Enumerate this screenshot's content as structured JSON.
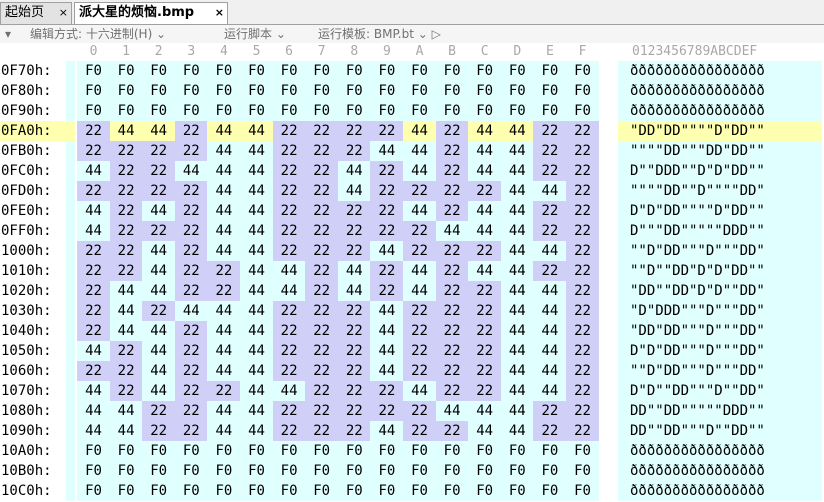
{
  "tabs": [
    {
      "label": "起始页",
      "close": "×"
    },
    {
      "label": "派大星的烦恼.bmp",
      "close": "×"
    }
  ],
  "toolbar": {
    "left_marker": "▾",
    "edit_mode": "编辑方式: 十六进制(H) ⌄",
    "run_script": "运行脚本 ⌄",
    "run_template": "运行模板: BMP.bt ⌄ ▷"
  },
  "column_header": {
    "hex_cols": [
      "0",
      "1",
      "2",
      "3",
      "4",
      "5",
      "6",
      "7",
      "8",
      "9",
      "A",
      "B",
      "C",
      "D",
      "E",
      "F"
    ],
    "ascii": "0123456789ABCDEF"
  },
  "selected_row": "0FA0h:",
  "rows": [
    {
      "addr": "0F70h:",
      "bytes": [
        "F0",
        "F0",
        "F0",
        "F0",
        "F0",
        "F0",
        "F0",
        "F0",
        "F0",
        "F0",
        "F0",
        "F0",
        "F0",
        "F0",
        "F0",
        "F0"
      ],
      "ascii": "ðððððððððððððððð"
    },
    {
      "addr": "0F80h:",
      "bytes": [
        "F0",
        "F0",
        "F0",
        "F0",
        "F0",
        "F0",
        "F0",
        "F0",
        "F0",
        "F0",
        "F0",
        "F0",
        "F0",
        "F0",
        "F0",
        "F0"
      ],
      "ascii": "ðððððððððððððððð"
    },
    {
      "addr": "0F90h:",
      "bytes": [
        "F0",
        "F0",
        "F0",
        "F0",
        "F0",
        "F0",
        "F0",
        "F0",
        "F0",
        "F0",
        "F0",
        "F0",
        "F0",
        "F0",
        "F0",
        "F0"
      ],
      "ascii": "ðððððððððððððððð"
    },
    {
      "addr": "0FA0h:",
      "bytes": [
        "22",
        "44",
        "44",
        "22",
        "44",
        "44",
        "22",
        "22",
        "22",
        "22",
        "44",
        "22",
        "44",
        "44",
        "22",
        "22"
      ],
      "ascii": "\"DD\"DD\"\"\"\"D\"DD\"\""
    },
    {
      "addr": "0FB0h:",
      "bytes": [
        "22",
        "22",
        "22",
        "22",
        "44",
        "44",
        "22",
        "22",
        "22",
        "44",
        "44",
        "22",
        "44",
        "44",
        "22",
        "22"
      ],
      "ascii": "\"\"\"\"DD\"\"\"DD\"DD\"\""
    },
    {
      "addr": "0FC0h:",
      "bytes": [
        "44",
        "22",
        "22",
        "44",
        "44",
        "44",
        "22",
        "22",
        "44",
        "22",
        "44",
        "22",
        "44",
        "44",
        "22",
        "22"
      ],
      "ascii": "D\"\"DDD\"\"D\"D\"DD\"\""
    },
    {
      "addr": "0FD0h:",
      "bytes": [
        "22",
        "22",
        "22",
        "22",
        "44",
        "44",
        "22",
        "22",
        "44",
        "22",
        "22",
        "22",
        "22",
        "44",
        "44",
        "22"
      ],
      "ascii": "\"\"\"\"DD\"\"D\"\"\"\"DD\""
    },
    {
      "addr": "0FE0h:",
      "bytes": [
        "44",
        "22",
        "44",
        "22",
        "44",
        "44",
        "22",
        "22",
        "22",
        "22",
        "44",
        "22",
        "44",
        "44",
        "22",
        "22"
      ],
      "ascii": "D\"D\"DD\"\"\"\"D\"DD\"\""
    },
    {
      "addr": "0FF0h:",
      "bytes": [
        "44",
        "22",
        "22",
        "22",
        "44",
        "44",
        "22",
        "22",
        "22",
        "22",
        "22",
        "44",
        "44",
        "44",
        "22",
        "22"
      ],
      "ascii": "D\"\"\"DD\"\"\"\"\"DDD\"\""
    },
    {
      "addr": "1000h:",
      "bytes": [
        "22",
        "22",
        "44",
        "22",
        "44",
        "44",
        "22",
        "22",
        "22",
        "44",
        "22",
        "22",
        "22",
        "44",
        "44",
        "22"
      ],
      "ascii": "\"\"D\"DD\"\"\"D\"\"\"DD\""
    },
    {
      "addr": "1010h:",
      "bytes": [
        "22",
        "22",
        "44",
        "22",
        "22",
        "44",
        "44",
        "22",
        "44",
        "22",
        "44",
        "22",
        "44",
        "44",
        "22",
        "22"
      ],
      "ascii": "\"\"D\"\"DD\"D\"D\"DD\"\""
    },
    {
      "addr": "1020h:",
      "bytes": [
        "22",
        "44",
        "44",
        "22",
        "22",
        "44",
        "44",
        "22",
        "44",
        "22",
        "44",
        "22",
        "22",
        "44",
        "44",
        "22"
      ],
      "ascii": "\"DD\"\"DD\"D\"D\"\"DD\""
    },
    {
      "addr": "1030h:",
      "bytes": [
        "22",
        "44",
        "22",
        "44",
        "44",
        "44",
        "22",
        "22",
        "22",
        "44",
        "22",
        "22",
        "22",
        "44",
        "44",
        "22"
      ],
      "ascii": "\"D\"DDD\"\"\"D\"\"\"DD\""
    },
    {
      "addr": "1040h:",
      "bytes": [
        "22",
        "44",
        "44",
        "22",
        "44",
        "44",
        "22",
        "22",
        "22",
        "44",
        "22",
        "22",
        "22",
        "44",
        "44",
        "22"
      ],
      "ascii": "\"DD\"DD\"\"\"D\"\"\"DD\""
    },
    {
      "addr": "1050h:",
      "bytes": [
        "44",
        "22",
        "44",
        "22",
        "44",
        "44",
        "22",
        "22",
        "22",
        "44",
        "22",
        "22",
        "22",
        "44",
        "44",
        "22"
      ],
      "ascii": "D\"D\"DD\"\"\"D\"\"\"DD\""
    },
    {
      "addr": "1060h:",
      "bytes": [
        "22",
        "22",
        "44",
        "22",
        "44",
        "44",
        "22",
        "22",
        "22",
        "44",
        "22",
        "22",
        "22",
        "44",
        "44",
        "22"
      ],
      "ascii": "\"\"D\"DD\"\"\"D\"\"\"DD\""
    },
    {
      "addr": "1070h:",
      "bytes": [
        "44",
        "22",
        "44",
        "22",
        "22",
        "44",
        "44",
        "22",
        "22",
        "22",
        "44",
        "22",
        "22",
        "44",
        "44",
        "22"
      ],
      "ascii": "D\"D\"\"DD\"\"\"D\"\"DD\""
    },
    {
      "addr": "1080h:",
      "bytes": [
        "44",
        "44",
        "22",
        "22",
        "44",
        "44",
        "22",
        "22",
        "22",
        "22",
        "22",
        "44",
        "44",
        "44",
        "22",
        "22"
      ],
      "ascii": "DD\"\"DD\"\"\"\"\"DDD\"\""
    },
    {
      "addr": "1090h:",
      "bytes": [
        "44",
        "44",
        "22",
        "22",
        "44",
        "44",
        "22",
        "22",
        "22",
        "44",
        "22",
        "22",
        "44",
        "44",
        "22",
        "22"
      ],
      "ascii": "DD\"\"DD\"\"\"D\"\"DD\"\""
    },
    {
      "addr": "10A0h:",
      "bytes": [
        "F0",
        "F0",
        "F0",
        "F0",
        "F0",
        "F0",
        "F0",
        "F0",
        "F0",
        "F0",
        "F0",
        "F0",
        "F0",
        "F0",
        "F0",
        "F0"
      ],
      "ascii": "ðððððððððððððððð"
    },
    {
      "addr": "10B0h:",
      "bytes": [
        "F0",
        "F0",
        "F0",
        "F0",
        "F0",
        "F0",
        "F0",
        "F0",
        "F0",
        "F0",
        "F0",
        "F0",
        "F0",
        "F0",
        "F0",
        "F0"
      ],
      "ascii": "ðððððððððððððððð"
    },
    {
      "addr": "10C0h:",
      "bytes": [
        "F0",
        "F0",
        "F0",
        "F0",
        "F0",
        "F0",
        "F0",
        "F0",
        "F0",
        "F0",
        "F0",
        "F0",
        "F0",
        "F0",
        "F0",
        "F0"
      ],
      "ascii": "ðððððððððððððððð"
    }
  ],
  "colors": {
    "byte_bg_alt": "#e0ffff",
    "byte_bg_22": "#cfcff7",
    "selection_row": "#ffffb0"
  }
}
